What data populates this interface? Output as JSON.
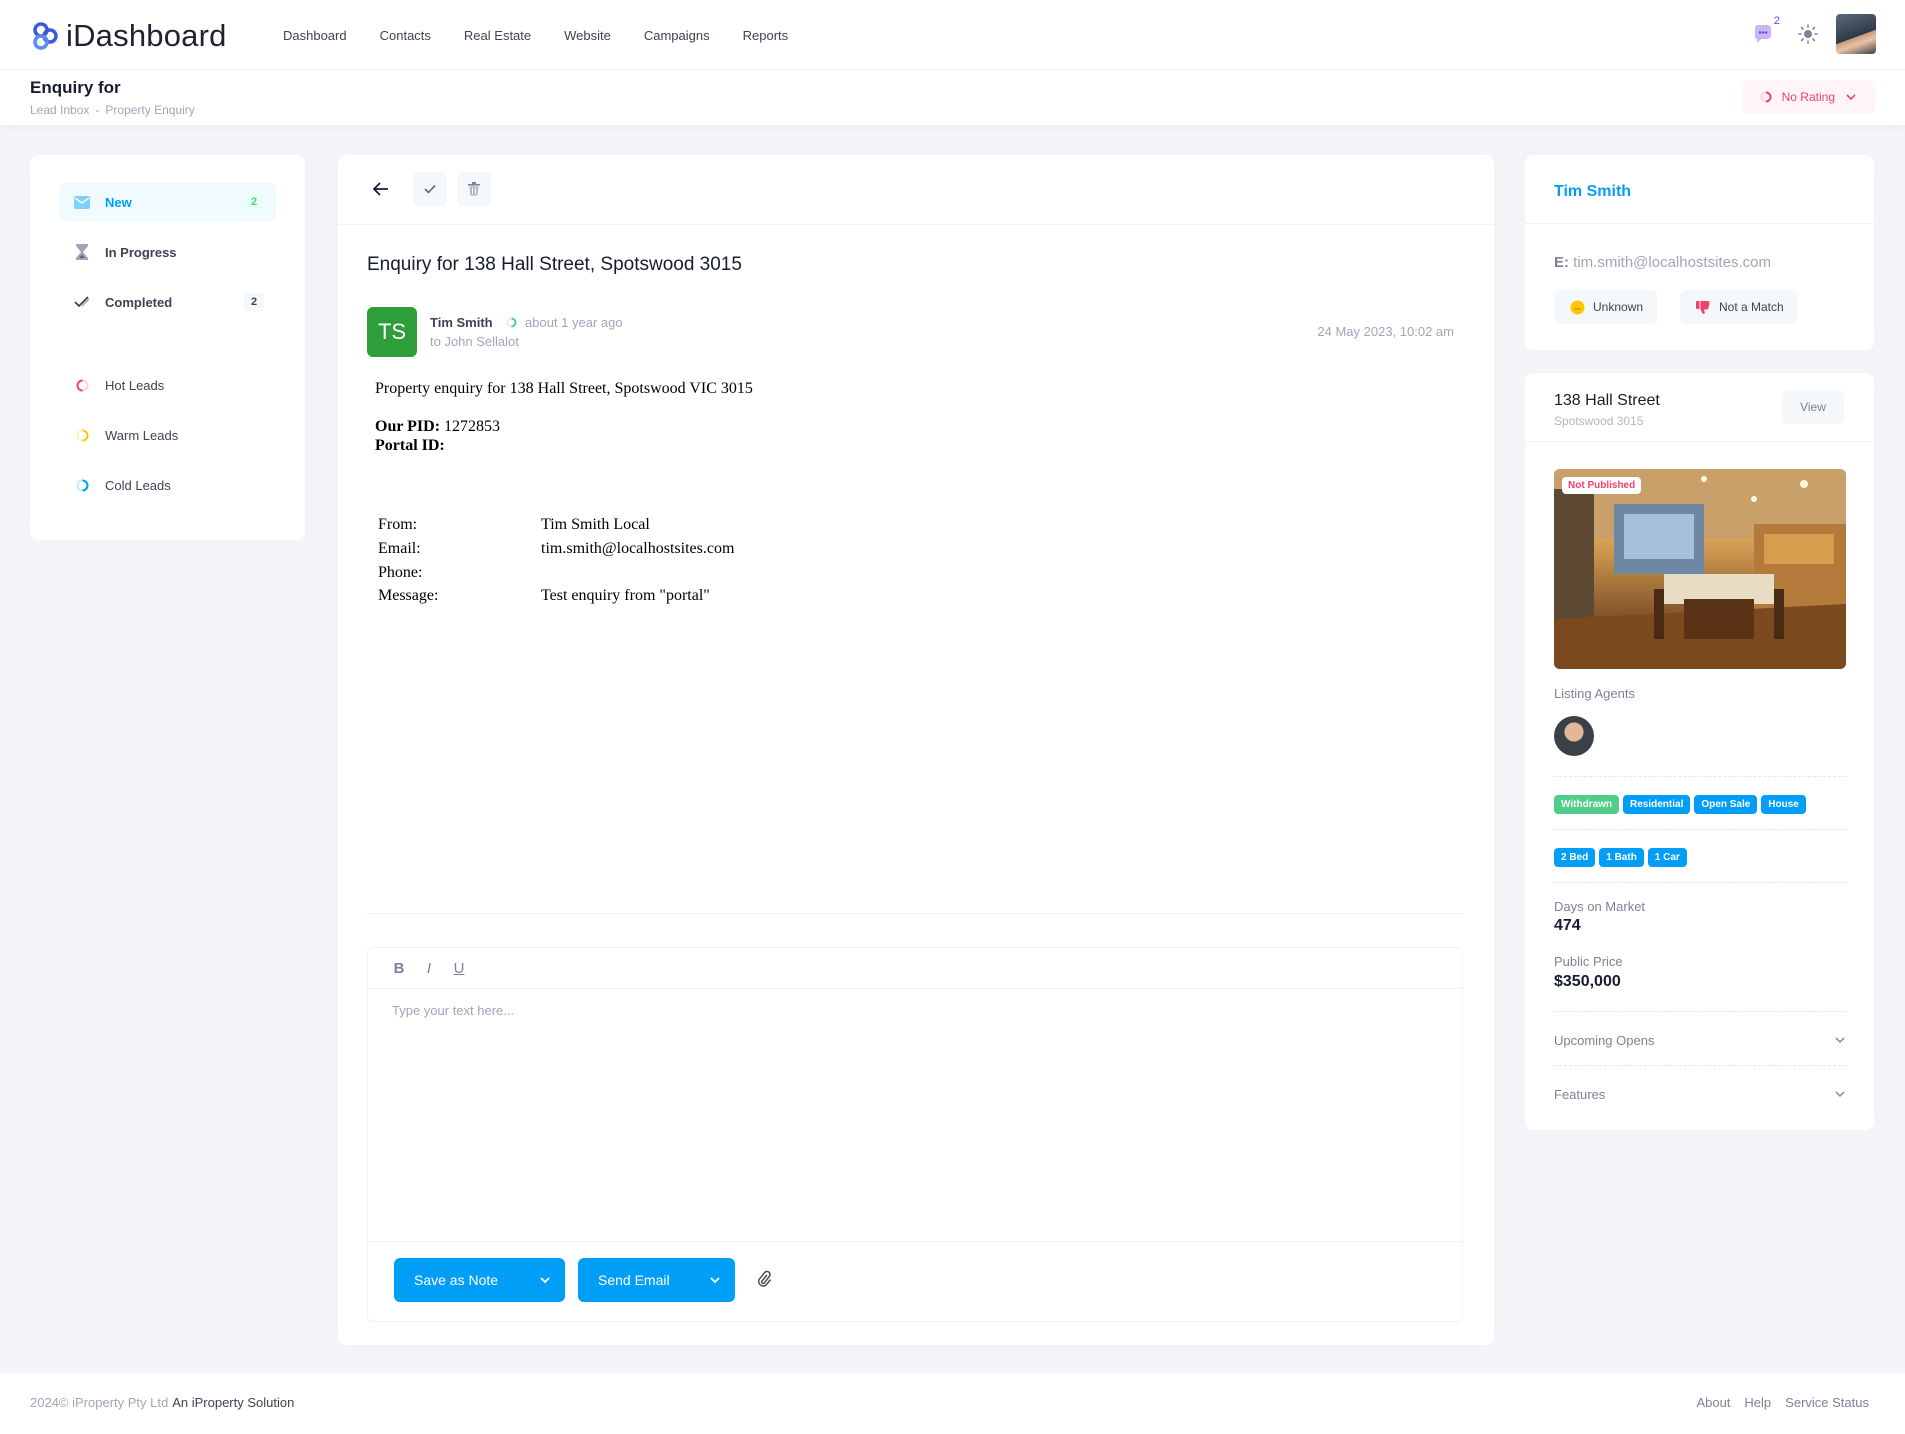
{
  "app": {
    "name": "iDashboard"
  },
  "nav": [
    "Dashboard",
    "Contacts",
    "Real Estate",
    "Website",
    "Campaigns",
    "Reports"
  ],
  "header": {
    "notification_count": "2"
  },
  "subheader": {
    "title": "Enquiry for",
    "breadcrumb": [
      "Lead Inbox",
      "-",
      "Property Enquiry"
    ],
    "rating": "No Rating"
  },
  "sidebar": {
    "folders": [
      {
        "label": "New",
        "count": "2"
      },
      {
        "label": "In Progress",
        "count": ""
      },
      {
        "label": "Completed",
        "count": "2"
      }
    ],
    "leads": [
      {
        "label": "Hot Leads",
        "color": "#f1416c"
      },
      {
        "label": "Warm Leads",
        "color": "#ffc700"
      },
      {
        "label": "Cold Leads",
        "color": "#009ef7"
      }
    ]
  },
  "message": {
    "subject": "Enquiry for 138 Hall Street, Spotswood 3015",
    "sender_initials": "TS",
    "sender_name": "Tim Smith",
    "time_ago": "about 1 year ago",
    "to": "to John Sellalot",
    "date": "24 May 2023, 10:02 am",
    "body": {
      "intro": "Property enquiry for 138 Hall Street, Spotswood VIC 3015",
      "pid_label": "Our PID:",
      "pid_value": " 1272853",
      "portal_label": "Portal ID:",
      "from_label": "From:",
      "from_value": "Tim Smith Local",
      "email_label": "Email:",
      "email_value": "tim.smith@localhostsites.com",
      "phone_label": "Phone:",
      "message_label": "Message:",
      "message_value": "Test enquiry from \"portal\""
    }
  },
  "editor": {
    "format": [
      "B",
      "I",
      "U"
    ],
    "placeholder": "Type your text here...",
    "save_label": "Save as Note",
    "send_label": "Send Email"
  },
  "contact": {
    "name": "Tim Smith",
    "email_prefix": "E:",
    "email": "tim.smith@localhostsites.com",
    "status": "Unknown",
    "match": "Not a Match"
  },
  "property": {
    "title": "138 Hall Street",
    "suburb": "Spotswood 3015",
    "view_label": "View",
    "image_badge": "Not Published",
    "agents_label": "Listing Agents",
    "tags": [
      "Withdrawn",
      "Residential",
      "Open Sale",
      "House"
    ],
    "features": [
      "2 Bed",
      "1 Bath",
      "1 Car"
    ],
    "days_label": "Days on Market",
    "days_value": "474",
    "price_label": "Public Price",
    "price_value": "$350,000",
    "accordions": [
      "Upcoming Opens",
      "Features"
    ]
  },
  "footer": {
    "copyright": "2024© iProperty Pty Ltd",
    "solution": "An iProperty Solution",
    "links": [
      "About",
      "Help",
      "Service Status"
    ]
  }
}
